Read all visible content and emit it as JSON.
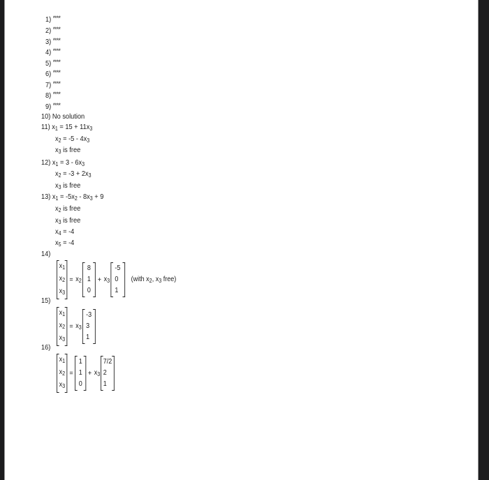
{
  "answers": [
    {
      "n": "1)",
      "text": "****"
    },
    {
      "n": "2)",
      "text": "****"
    },
    {
      "n": "3)",
      "text": "****"
    },
    {
      "n": "4)",
      "text": "****"
    },
    {
      "n": "5)",
      "text": "****"
    },
    {
      "n": "6)",
      "text": "****"
    },
    {
      "n": "7)",
      "text": "****"
    },
    {
      "n": "8)",
      "text": "****"
    },
    {
      "n": "9)",
      "text": "****"
    },
    {
      "n": "10)",
      "text": "No solution"
    }
  ],
  "q11": {
    "n": "11)",
    "lines": [
      {
        "var": "x",
        "sub": "1",
        "rhs_a": " = 15 + 11x",
        "rhs_sub": "3"
      },
      {
        "var": "x",
        "sub": "2",
        "rhs_a": " = -5 - 4x",
        "rhs_sub": "3"
      },
      {
        "var": "x",
        "sub": "3",
        "rhs_a": " is free",
        "rhs_sub": ""
      }
    ]
  },
  "q12": {
    "n": "12)",
    "lines": [
      {
        "var": "x",
        "sub": "1",
        "rhs_a": " = 3 - 6x",
        "rhs_sub": "3"
      },
      {
        "var": "x",
        "sub": "2",
        "rhs_a": " = -3 + 2x",
        "rhs_sub": "3"
      },
      {
        "var": "x",
        "sub": "3",
        "rhs_a": " is free",
        "rhs_sub": ""
      }
    ]
  },
  "q13": {
    "n": "13)",
    "line1": {
      "a": " = -5x",
      "a_sub": "2",
      "b": " - 8x",
      "b_sub": "3",
      "c": " + 9"
    },
    "lines": [
      {
        "var": "x",
        "sub": "2",
        "rhs": " is free"
      },
      {
        "var": "x",
        "sub": "3",
        "rhs": " is free"
      },
      {
        "var": "x",
        "sub": "4",
        "rhs": " =  -4"
      },
      {
        "var": "x",
        "sub": "5",
        "rhs": " =  -4"
      }
    ]
  },
  "q14": {
    "n": "14)",
    "lhs": [
      "x1",
      "x2",
      "x3"
    ],
    "eq": "=",
    "coef1": "x2",
    "vec1": [
      "8",
      "1",
      "0"
    ],
    "plus": "+",
    "coef2": "x3",
    "vec2": [
      "-5",
      "0",
      "1"
    ],
    "note_a": "(with x",
    "note_sub1": "2",
    "note_b": ", x",
    "note_sub2": "3",
    "note_c": " free)"
  },
  "q15": {
    "n": "15)",
    "lhs": [
      "x1",
      "x2",
      "x3"
    ],
    "eq": "=",
    "coef1": "x3",
    "vec1": [
      "-3",
      "3",
      "1"
    ]
  },
  "q16": {
    "n": "16)",
    "lhs": [
      "x1",
      "x2",
      "x3"
    ],
    "eq": "=",
    "vec0": [
      "1",
      "1",
      "0"
    ],
    "plus": "+",
    "coef1": "x3",
    "vec1": [
      "7/2",
      "2",
      "1"
    ]
  }
}
